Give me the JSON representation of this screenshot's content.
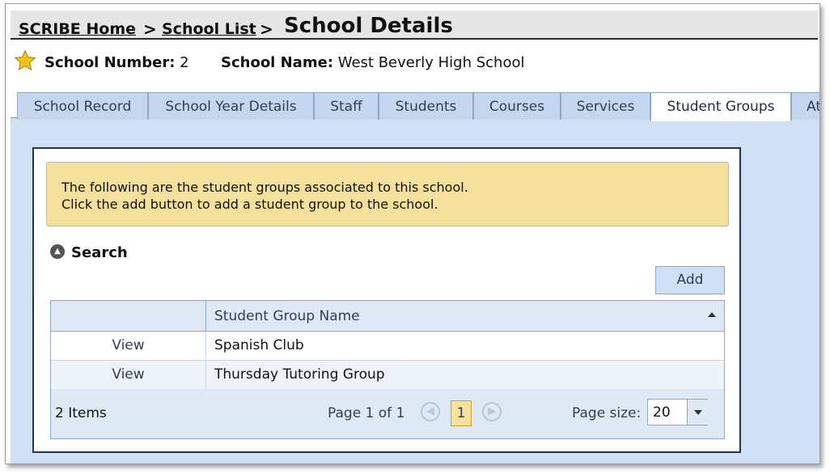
{
  "breadcrumb": {
    "home": "SCRIBE Home",
    "sep1": ">",
    "list": "School List",
    "sep2": ">",
    "current": "School Details"
  },
  "school": {
    "number_label": "School Number:",
    "number_value": "2",
    "name_label": "School Name:",
    "name_value": "West Beverly High School"
  },
  "tabs": [
    {
      "label": "School Record"
    },
    {
      "label": "School Year Details"
    },
    {
      "label": "Staff"
    },
    {
      "label": "Students"
    },
    {
      "label": "Courses"
    },
    {
      "label": "Services"
    },
    {
      "label": "Student Groups",
      "active": true
    },
    {
      "label": "At"
    }
  ],
  "notice": {
    "line1": "The following are the student groups associated to this school.",
    "line2": "Click the add button to add a student group to the school."
  },
  "search": {
    "label": "Search",
    "icon": "collapse-up-icon"
  },
  "add_label": "Add",
  "grid": {
    "column": "Student Group Name",
    "rows": [
      {
        "action": "View",
        "name": "Spanish Club"
      },
      {
        "action": "View",
        "name": "Thursday Tutoring Group"
      }
    ]
  },
  "pager": {
    "items": "2 Items",
    "page_label": "Page 1 of 1",
    "current_page": "1",
    "size_label": "Page size:",
    "size_value": "20"
  },
  "colors": {
    "tab_bg": "#c4d7ef",
    "area_bg": "#cfdff4",
    "notice_bg": "#f5e09c",
    "panel_border": "#1f3552"
  }
}
